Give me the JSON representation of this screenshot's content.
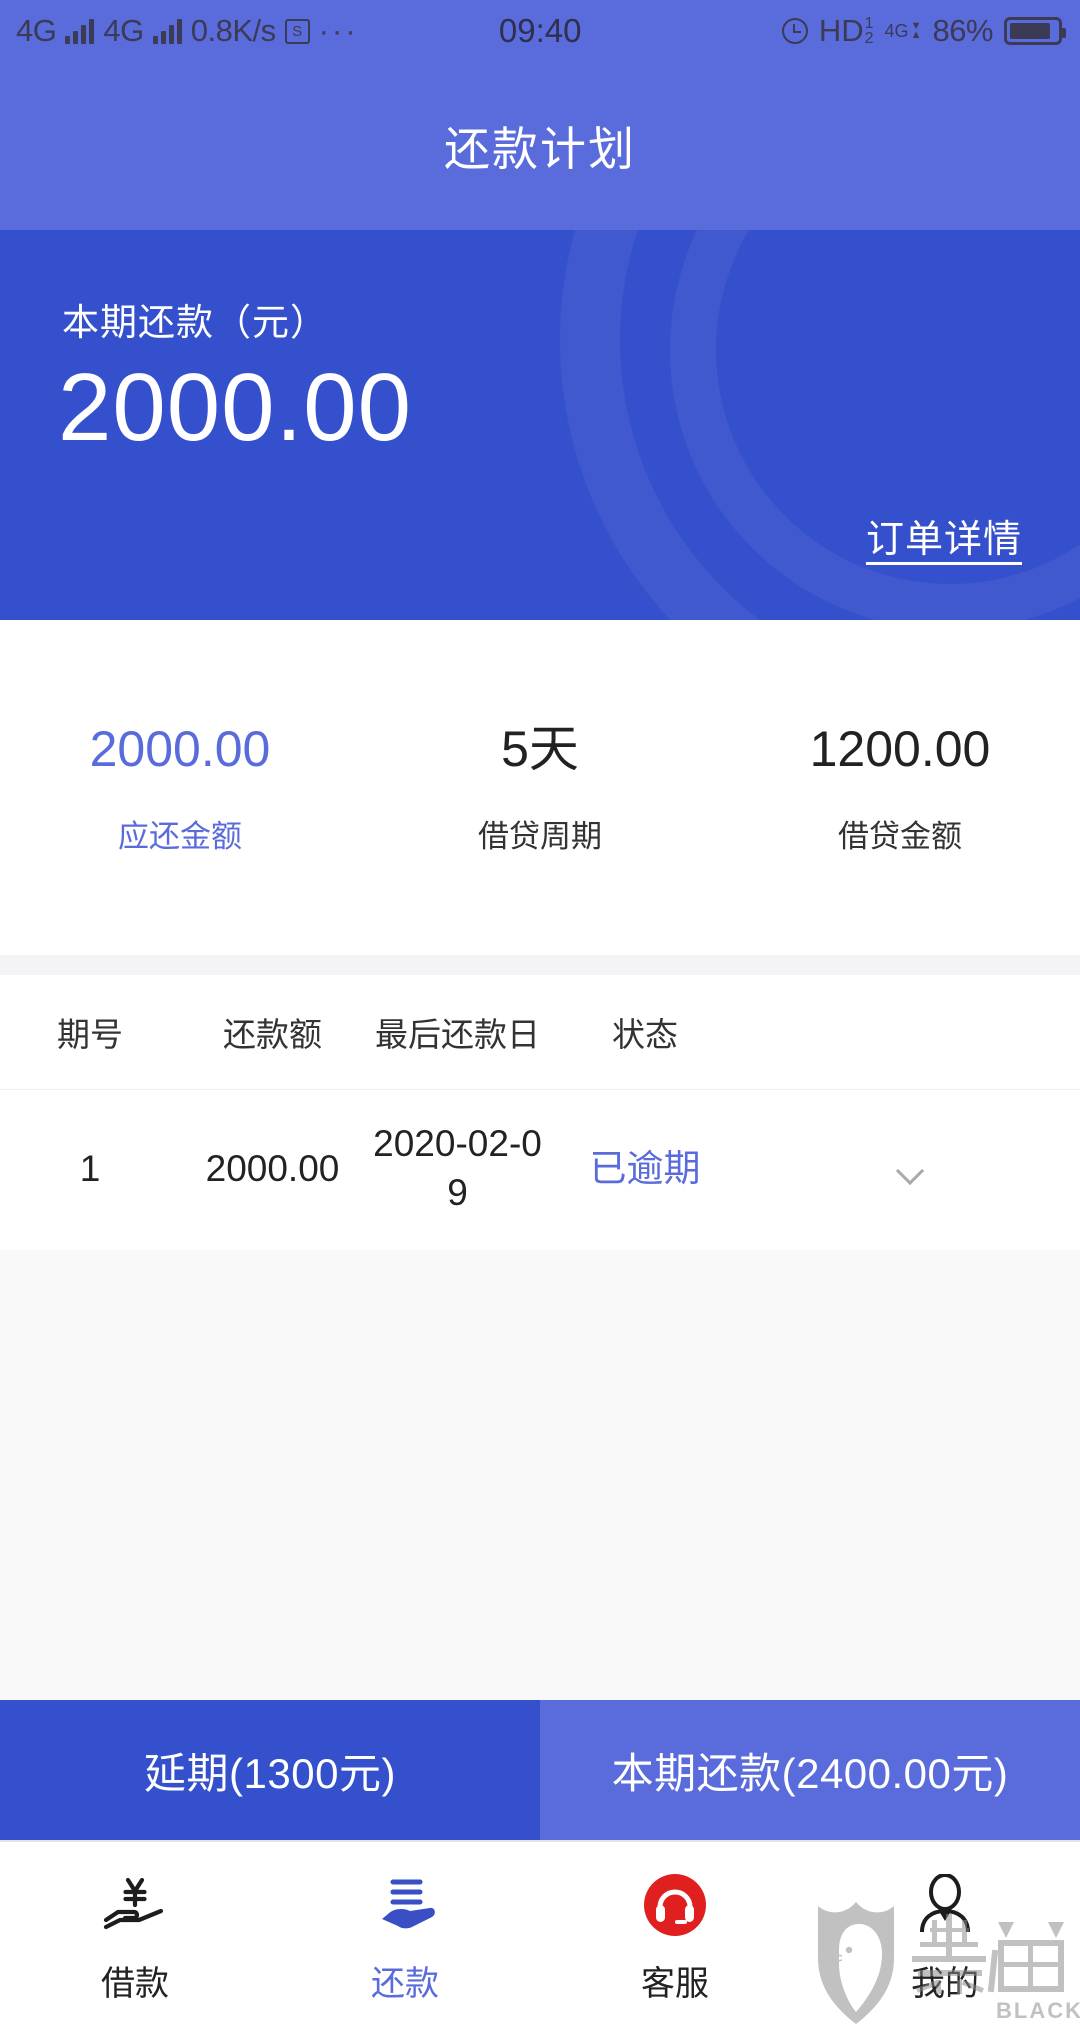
{
  "status_bar": {
    "network_1": "4G",
    "network_2": "4G",
    "data_rate": "0.8K/s",
    "sim_icon": "S",
    "more_dots": "···",
    "time": "09:40",
    "alarm_icon": "alarm-clock-icon",
    "hd_label": "HD",
    "hd_sup": "1",
    "hd_sub": "2",
    "cell_4g": "4G",
    "battery_percent": "86%"
  },
  "header": {
    "title": "还款计划"
  },
  "hero": {
    "label": "本期还款（元）",
    "amount": "2000.00",
    "detail_link": "订单详情",
    "bg_color": "#3550CC"
  },
  "stats": [
    {
      "value": "2000.00",
      "label": "应还金额",
      "accent": true
    },
    {
      "value": "5天",
      "label": "借贷周期",
      "accent": false
    },
    {
      "value": "1200.00",
      "label": "借贷金额",
      "accent": false
    }
  ],
  "table": {
    "columns": [
      "期号",
      "还款额",
      "最后还款日",
      "状态"
    ],
    "rows": [
      {
        "period": "1",
        "amount": "2000.00",
        "due_date": "2020-02-09",
        "status": "已逾期",
        "status_color": "#5A6BDC",
        "expand_icon": "chevron-down-icon"
      }
    ]
  },
  "actions": {
    "extend": "延期(1300元)",
    "repay": "本期还款(2400.00元)"
  },
  "tabbar": {
    "items": [
      {
        "label": "借款",
        "icon": "hand-yuan-icon",
        "active": false
      },
      {
        "label": "还款",
        "icon": "hand-bills-icon",
        "active": true
      },
      {
        "label": "客服",
        "icon": "headset-icon",
        "active": false
      },
      {
        "label": "我的",
        "icon": "person-icon",
        "active": false
      }
    ]
  },
  "watermark": {
    "text_cn": "黑猫",
    "text_en": "BLACK CAT"
  }
}
